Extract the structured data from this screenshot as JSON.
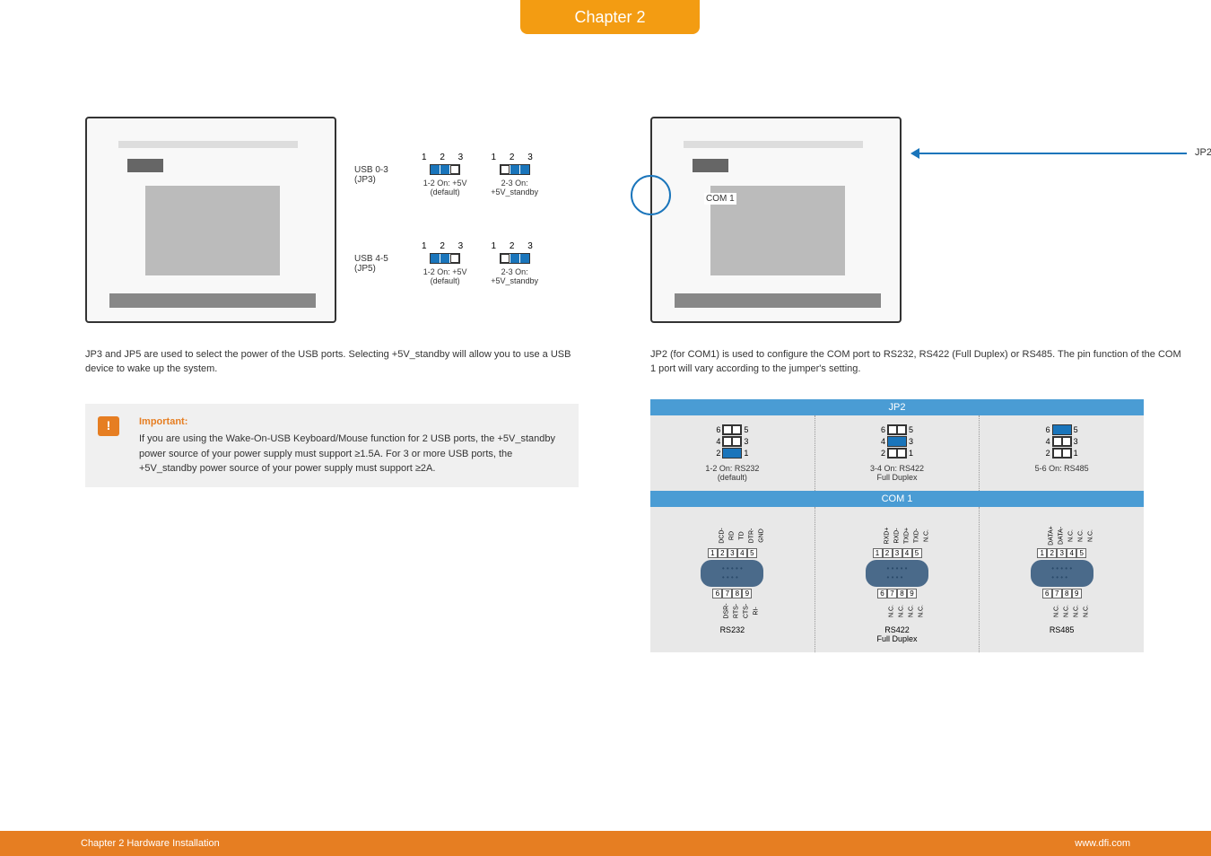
{
  "chapter_tab": "Chapter 2",
  "left": {
    "usb_groups": [
      {
        "label": "USB 0-3\n(JP3)",
        "options": [
          {
            "nums": "1  2  3",
            "filled": [
              0,
              1
            ],
            "desc": "1-2 On: +5V\n(default)"
          },
          {
            "nums": "1  2  3",
            "filled": [
              1,
              2
            ],
            "desc": "2-3 On:\n+5V_standby"
          }
        ]
      },
      {
        "label": "USB 4-5\n(JP5)",
        "options": [
          {
            "nums": "1  2  3",
            "filled": [
              0,
              1
            ],
            "desc": "1-2 On: +5V\n(default)"
          },
          {
            "nums": "1  2  3",
            "filled": [
              1,
              2
            ],
            "desc": "2-3 On:\n+5V_standby"
          }
        ]
      }
    ],
    "desc": "JP3 and JP5 are used to select the power of the USB ports. Selecting +5V_standby will allow you to use a USB device to wake up the system.",
    "important_title": "Important:",
    "important_text": "If you are using the Wake-On-USB Keyboard/Mouse function for 2 USB ports, the +5V_standby power source of your power supply must support ≥1.5A. For 3 or more USB ports, the +5V_standby power source of your power supply must support ≥2A."
  },
  "right": {
    "com1_label": "COM 1",
    "jp2_label": "JP2",
    "desc": "JP2 (for COM1) is used to configure the COM port to RS232, RS422 (Full Duplex) or RS485. The pin function of the COM 1 port will vary according to the jumper's setting.",
    "jp2_header": "JP2",
    "jp2_options": [
      {
        "rows": [
          {
            "left": "6",
            "right": "5",
            "filled": []
          },
          {
            "left": "4",
            "right": "3",
            "filled": []
          },
          {
            "left": "2",
            "right": "1",
            "filled": [
              0,
              1
            ]
          }
        ],
        "label": "1-2 On: RS232\n(default)"
      },
      {
        "rows": [
          {
            "left": "6",
            "right": "5",
            "filled": []
          },
          {
            "left": "4",
            "right": "3",
            "filled": [
              0,
              1
            ]
          },
          {
            "left": "2",
            "right": "1",
            "filled": []
          }
        ],
        "label": "3-4 On: RS422\nFull Duplex"
      },
      {
        "rows": [
          {
            "left": "6",
            "right": "5",
            "filled": [
              0,
              1
            ]
          },
          {
            "left": "4",
            "right": "3",
            "filled": []
          },
          {
            "left": "2",
            "right": "1",
            "filled": []
          }
        ],
        "label": "5-6 On: RS485"
      }
    ],
    "com1_header": "COM 1",
    "com_modes": [
      {
        "top_pins": [
          "DCD-",
          "RD",
          "TD",
          "DTR-",
          "GND"
        ],
        "top_nums": [
          "1",
          "2",
          "3",
          "4",
          "5"
        ],
        "bot_nums": [
          "6",
          "7",
          "8",
          "9"
        ],
        "bot_pins": [
          "DSR-",
          "RTS-",
          "CTS-",
          "RI-"
        ],
        "mode": "RS232"
      },
      {
        "top_pins": [
          "RXD+",
          "RXD-",
          "TXD+",
          "TXD-",
          "N.C."
        ],
        "top_nums": [
          "1",
          "2",
          "3",
          "4",
          "5"
        ],
        "bot_nums": [
          "6",
          "7",
          "8",
          "9"
        ],
        "bot_pins": [
          "N.C.",
          "N.C.",
          "N.C.",
          "N.C."
        ],
        "mode": "RS422\nFull Duplex"
      },
      {
        "top_pins": [
          "DATA+",
          "DATA-",
          "N.C.",
          "N.C.",
          "N.C."
        ],
        "top_nums": [
          "1",
          "2",
          "3",
          "4",
          "5"
        ],
        "bot_nums": [
          "6",
          "7",
          "8",
          "9"
        ],
        "bot_pins": [
          "N.C.",
          "N.C.",
          "N.C.",
          "N.C."
        ],
        "mode": "RS485"
      }
    ]
  },
  "footer": {
    "left": "Chapter 2 Hardware Installation",
    "right": "www.dfi.com"
  }
}
